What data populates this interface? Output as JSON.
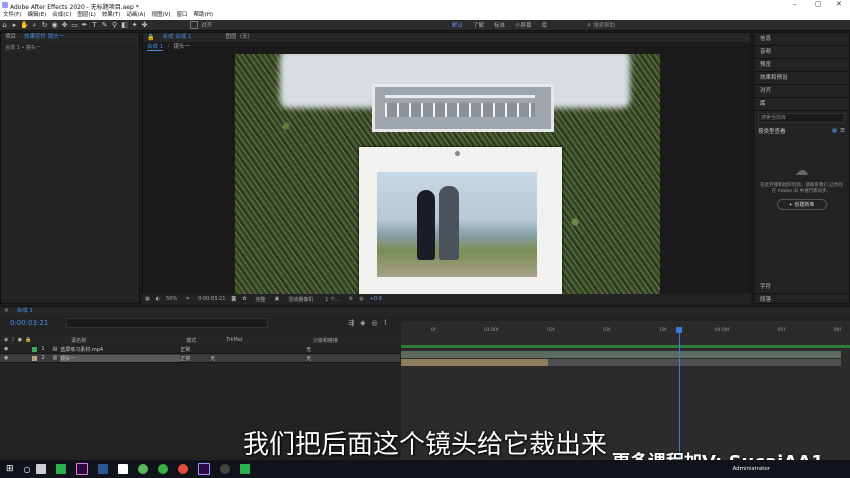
{
  "window": {
    "title": "Adobe After Effects 2020 - 无标题项目.aep *",
    "minimize": "–",
    "maximize": "▢",
    "close": "✕"
  },
  "menu": [
    "文件(F)",
    "编辑(E)",
    "合成(C)",
    "图层(L)",
    "效果(T)",
    "动画(A)",
    "视图(V)",
    "窗口",
    "帮助(H)"
  ],
  "toolbar": {
    "snap_label": "对齐",
    "workspaces": [
      "默认",
      "了解",
      "标准",
      "小屏幕",
      "库"
    ],
    "active_workspace": "默认",
    "search_placeholder": "搜索帮助"
  },
  "project_panel": {
    "tabs": [
      "项目",
      "效果控件 镜头一"
    ],
    "subtitle": "合成 1 • 镜头一"
  },
  "comp_panel": {
    "tabs": [
      "合成 合成 1",
      "图层（无）"
    ],
    "breadcrumb": [
      "合成 1",
      "镜头一"
    ],
    "zoom": "50%",
    "timecode": "0:00:03:21",
    "resolution": "完整",
    "camera": "活动摄像机",
    "views": "1 个...",
    "offset": "+0.0"
  },
  "right_panel": {
    "items": [
      "信息",
      "音频",
      "预览",
      "效果和预设",
      "对齐",
      "库"
    ],
    "search_label": "搜索当前库",
    "browse_label": "按类型查看",
    "empty_text": "在此存储和组织资源。请联系我们,让你的在 Adobe ID 中进行库同步。",
    "create_button": "+ 创建新库",
    "bottom_items": [
      "字符",
      "段落"
    ]
  },
  "timeline": {
    "tab": "合成 1",
    "timecode": "0:00:03:21",
    "search_placeholder": "",
    "headers": {
      "source": "源名称",
      "mode": "模式",
      "trkmat": "TrkMat",
      "parent": "父级和链接"
    },
    "layers": [
      {
        "num": "1",
        "name": "蓝屏练习素材.mp4",
        "mode": "正常",
        "trkmat": "",
        "parent": "无"
      },
      {
        "num": "2",
        "name": "镜头一",
        "mode": "正常",
        "trkmat": "无",
        "parent": "无"
      }
    ],
    "ruler": [
      "0f",
      "01:00f",
      "02f",
      "03f",
      "10f",
      "04:00f",
      "05f",
      "06f"
    ]
  },
  "subtitle": "我们把后面这个镜头给它裁出来",
  "watermark": "更多课程加V: SucaiAA1",
  "taskbar": {
    "user_label": "Administrator"
  }
}
